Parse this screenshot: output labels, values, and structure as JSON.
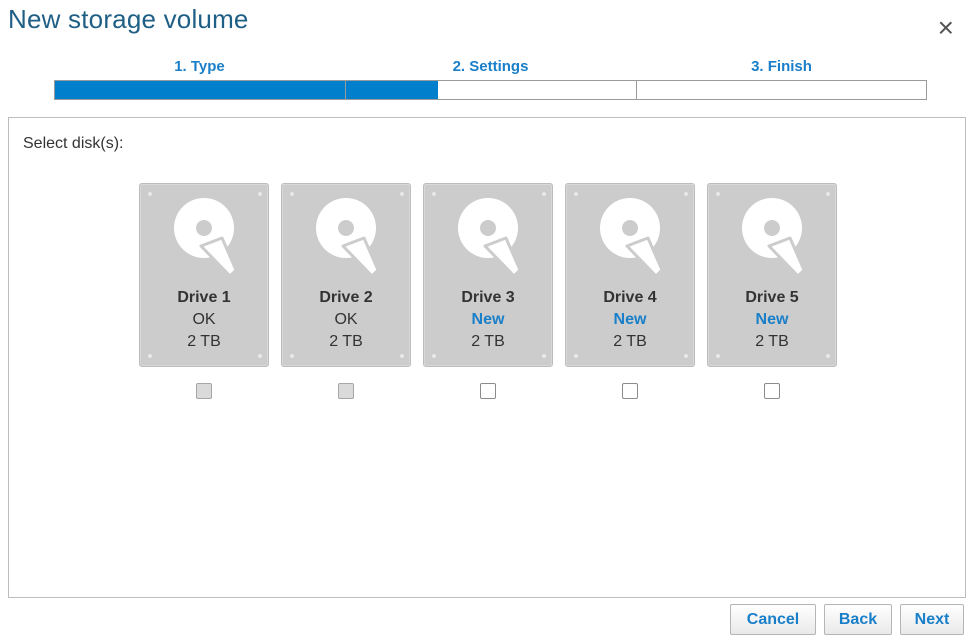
{
  "dialog": {
    "title": "New storage volume",
    "close_symbol": "×"
  },
  "wizard": {
    "steps": [
      {
        "label": "1. Type"
      },
      {
        "label": "2. Settings"
      },
      {
        "label": "3. Finish"
      }
    ],
    "progress_fraction": 0.44
  },
  "panel": {
    "select_label": "Select disk(s):"
  },
  "drives": [
    {
      "name": "Drive 1",
      "status": "OK",
      "size": "2 TB",
      "is_new": false,
      "selectable": false,
      "checked": false
    },
    {
      "name": "Drive 2",
      "status": "OK",
      "size": "2 TB",
      "is_new": false,
      "selectable": false,
      "checked": false
    },
    {
      "name": "Drive 3",
      "status": "New",
      "size": "2 TB",
      "is_new": true,
      "selectable": true,
      "checked": false
    },
    {
      "name": "Drive 4",
      "status": "New",
      "size": "2 TB",
      "is_new": true,
      "selectable": true,
      "checked": false
    },
    {
      "name": "Drive 5",
      "status": "New",
      "size": "2 TB",
      "is_new": true,
      "selectable": true,
      "checked": false
    }
  ],
  "buttons": {
    "cancel": "Cancel",
    "back": "Back",
    "next": "Next"
  },
  "colors": {
    "accent": "#1a7fc9",
    "progress_fill": "#0080cc",
    "title": "#1f5f86",
    "drive_card": "#cccccc"
  },
  "icons": {
    "close": "close-icon",
    "drive": "hard-disk-icon"
  }
}
